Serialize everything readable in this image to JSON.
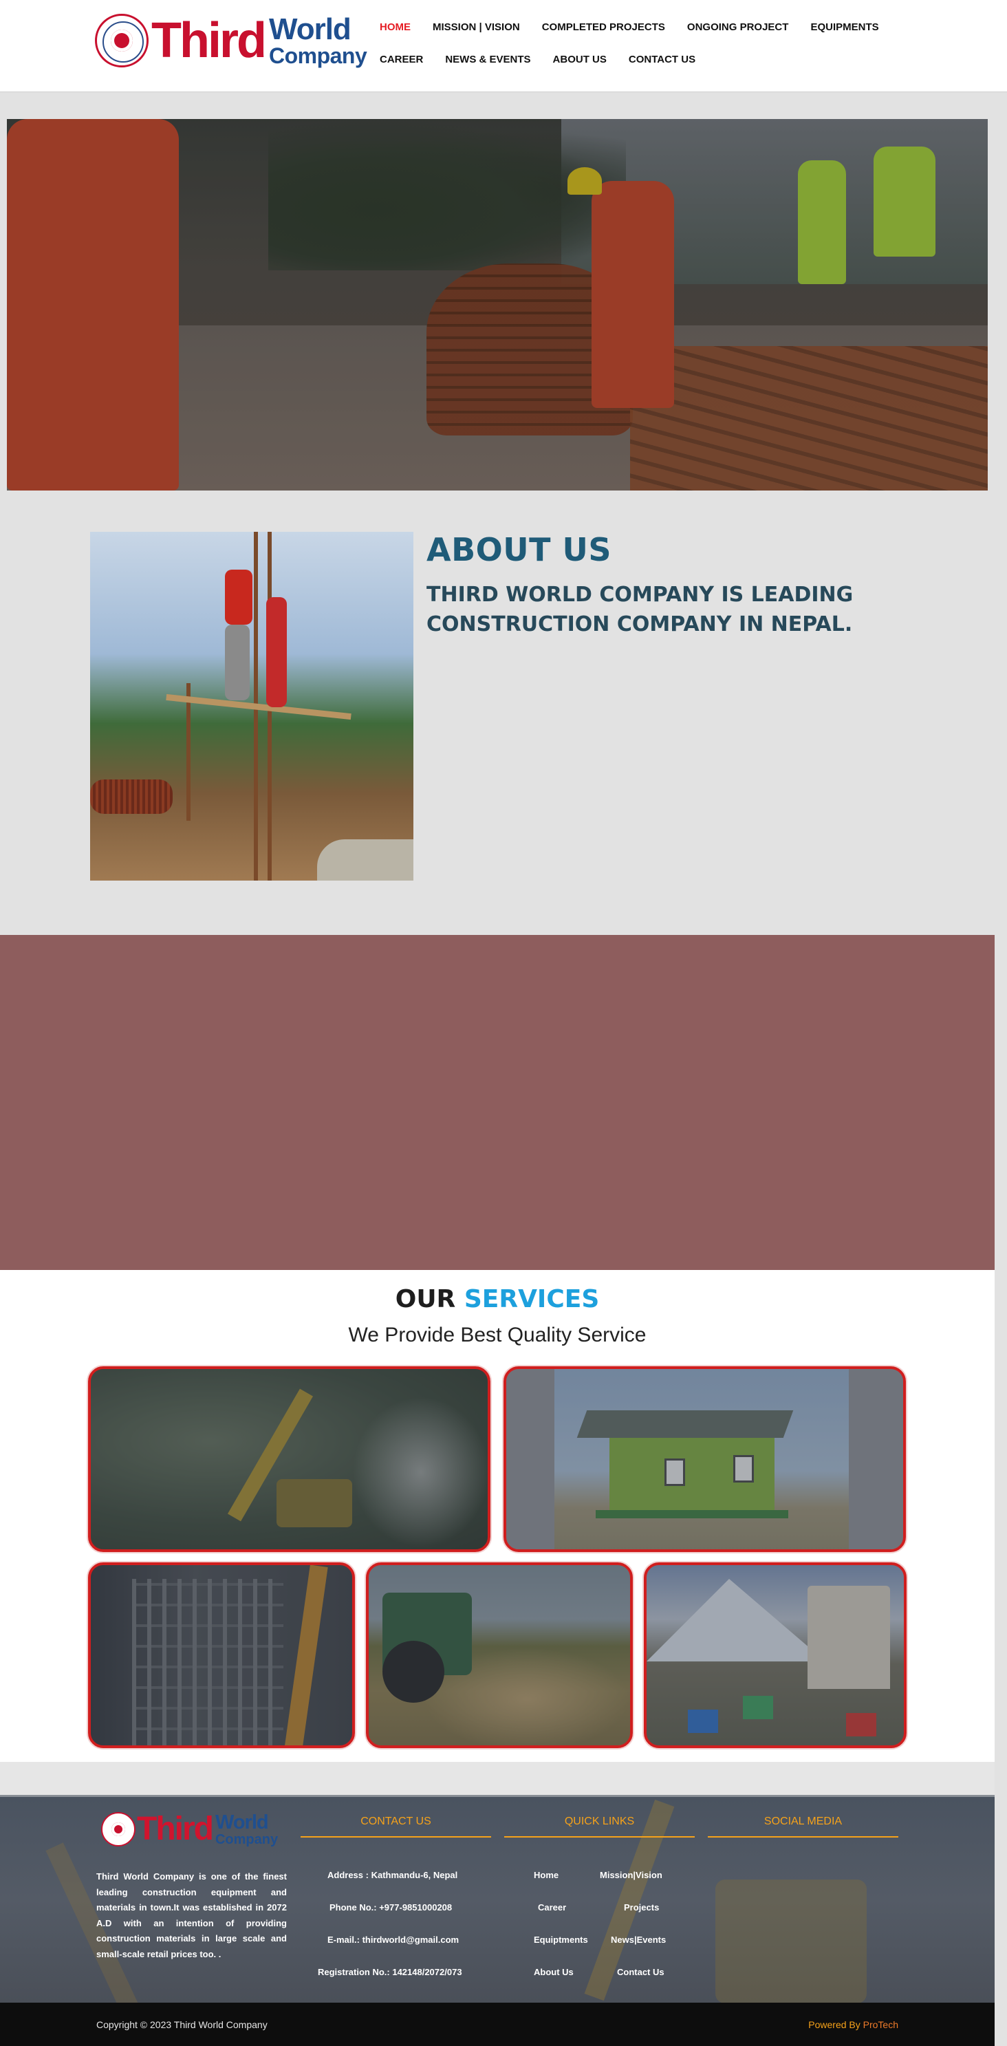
{
  "brand": {
    "logo_main": "Third",
    "logo_world": "World",
    "logo_company": "Company",
    "name_color": "#c8102e",
    "accent_color": "#1f4f8f"
  },
  "nav": {
    "items": [
      {
        "label": "HOME",
        "active": true
      },
      {
        "label": "MISSION | VISION",
        "active": false
      },
      {
        "label": "COMPLETED PROJECTS",
        "active": false
      },
      {
        "label": "ONGOING PROJECT",
        "active": false
      },
      {
        "label": "EQUIPMENTS",
        "active": false
      },
      {
        "label": "CAREER",
        "active": false
      },
      {
        "label": "NEWS & EVENTS",
        "active": false
      },
      {
        "label": "ABOUT US",
        "active": false
      },
      {
        "label": "CONTACT US",
        "active": false
      }
    ],
    "active_color": "#e51d24"
  },
  "about": {
    "title": "ABOUT US",
    "subtitle": "THIRD WORLD COMPANY IS LEADING CONSTRUCTION COMPANY IN NEPAL."
  },
  "services": {
    "title_part1": "OUR",
    "title_part2": "SERVICES",
    "subtitle": "We Provide Best Quality Service",
    "highlight_color": "#1da0dd",
    "card_border_color": "#d01e1e"
  },
  "footer": {
    "about_text": "Third World Company is one of the finest leading construction equipment and materials in town.It was established in 2072 A.D with an intention of providing construction materials in large scale and small-scale retail prices too. .",
    "contact": {
      "heading": "CONTACT US",
      "address": "Address :  Kathmandu-6, Nepal",
      "phone": "Phone No.: +977-9851000208",
      "email": "E-mail.: thirdworld@gmail.com",
      "registration": "Registration No.: 142148/2072/073"
    },
    "quick_links": {
      "heading": "QUICK LINKS",
      "links": [
        "Home",
        "Mission|Vision",
        "Career",
        "Projects",
        "Equiptments",
        "News|Events",
        "About Us",
        "Contact Us"
      ]
    },
    "social": {
      "heading": "SOCIAL MEDIA"
    },
    "heading_color": "#f6a21a"
  },
  "copyright": {
    "text": "Copyright © 2023 Third World Company",
    "powered_prefix": "Powered By ",
    "powered_brand": "ProTech"
  }
}
